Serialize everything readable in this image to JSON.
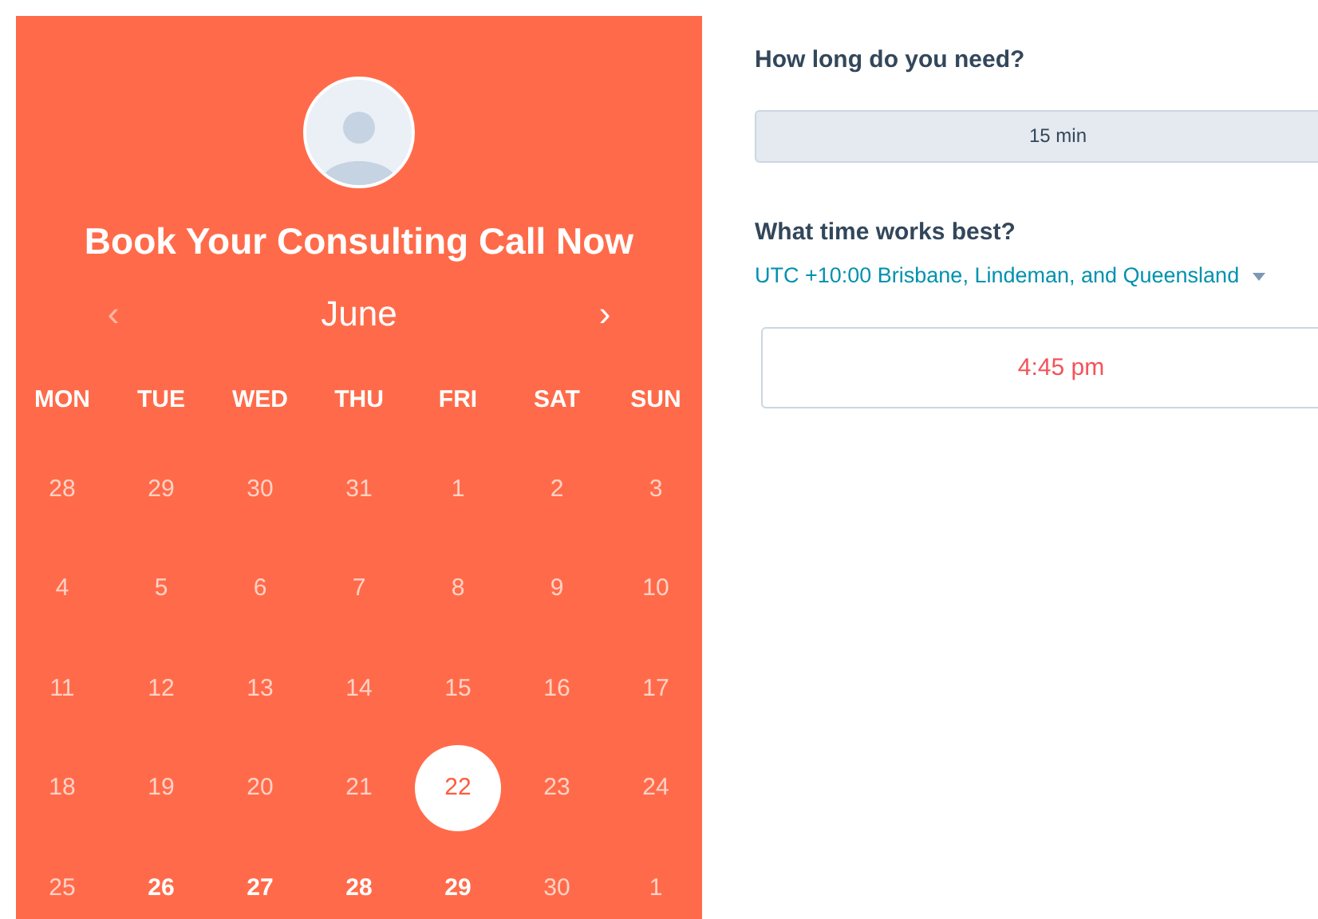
{
  "booking_panel": {
    "title": "Book Your Consulting Call Now",
    "month": "June",
    "prev": "‹",
    "next": "›",
    "weekdays": [
      "MON",
      "TUE",
      "WED",
      "THU",
      "FRI",
      "SAT",
      "SUN"
    ],
    "weeks": [
      [
        {
          "day": "28",
          "available": false,
          "selected": false
        },
        {
          "day": "29",
          "available": false,
          "selected": false
        },
        {
          "day": "30",
          "available": false,
          "selected": false
        },
        {
          "day": "31",
          "available": false,
          "selected": false
        },
        {
          "day": "1",
          "available": false,
          "selected": false
        },
        {
          "day": "2",
          "available": false,
          "selected": false
        },
        {
          "day": "3",
          "available": false,
          "selected": false
        }
      ],
      [
        {
          "day": "4",
          "available": false,
          "selected": false
        },
        {
          "day": "5",
          "available": false,
          "selected": false
        },
        {
          "day": "6",
          "available": false,
          "selected": false
        },
        {
          "day": "7",
          "available": false,
          "selected": false
        },
        {
          "day": "8",
          "available": false,
          "selected": false
        },
        {
          "day": "9",
          "available": false,
          "selected": false
        },
        {
          "day": "10",
          "available": false,
          "selected": false
        }
      ],
      [
        {
          "day": "11",
          "available": false,
          "selected": false
        },
        {
          "day": "12",
          "available": false,
          "selected": false
        },
        {
          "day": "13",
          "available": false,
          "selected": false
        },
        {
          "day": "14",
          "available": false,
          "selected": false
        },
        {
          "day": "15",
          "available": false,
          "selected": false
        },
        {
          "day": "16",
          "available": false,
          "selected": false
        },
        {
          "day": "17",
          "available": false,
          "selected": false
        }
      ],
      [
        {
          "day": "18",
          "available": false,
          "selected": false
        },
        {
          "day": "19",
          "available": false,
          "selected": false
        },
        {
          "day": "20",
          "available": false,
          "selected": false
        },
        {
          "day": "21",
          "available": false,
          "selected": false
        },
        {
          "day": "22",
          "available": true,
          "selected": true
        },
        {
          "day": "23",
          "available": false,
          "selected": false
        },
        {
          "day": "24",
          "available": false,
          "selected": false
        }
      ],
      [
        {
          "day": "25",
          "available": false,
          "selected": false
        },
        {
          "day": "26",
          "available": true,
          "selected": false
        },
        {
          "day": "27",
          "available": true,
          "selected": false
        },
        {
          "day": "28",
          "available": true,
          "selected": false
        },
        {
          "day": "29",
          "available": true,
          "selected": false
        },
        {
          "day": "30",
          "available": false,
          "selected": false
        },
        {
          "day": "1",
          "available": false,
          "selected": false
        }
      ]
    ]
  },
  "duration": {
    "heading": "How long do you need?",
    "options": [
      {
        "label": "15 min",
        "selected": true
      }
    ]
  },
  "time": {
    "heading": "What time works best?",
    "timezone": "UTC +10:00 Brisbane, Lindeman, and Queensland",
    "slots": [
      "4:45 pm"
    ]
  }
}
